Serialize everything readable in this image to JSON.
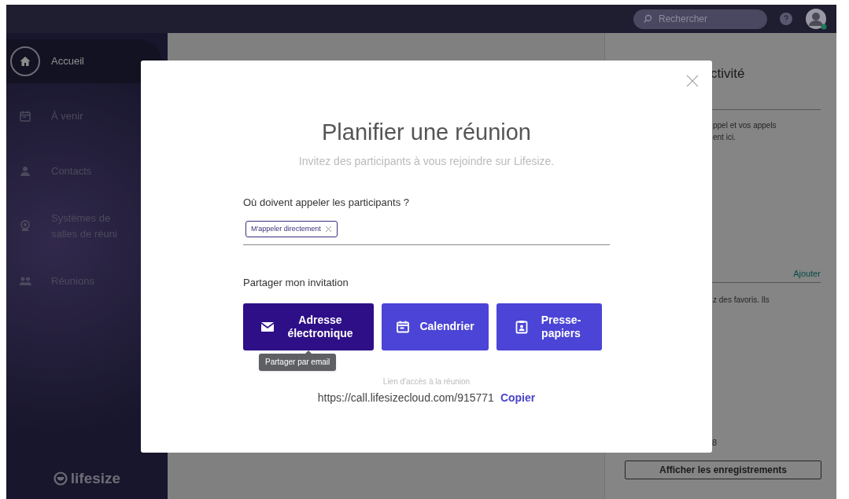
{
  "topbar": {
    "search": {
      "placeholder": "Rechercher"
    }
  },
  "sidebar": {
    "items": [
      {
        "label": "Accueil",
        "kind": "home",
        "selected": true
      },
      {
        "label": "À venir",
        "kind": "calendar",
        "selected": false
      },
      {
        "label": "Contacts",
        "kind": "person",
        "selected": false
      },
      {
        "label": "Systèmes de salles de réuni",
        "kind": "webcam",
        "selected": false
      },
      {
        "label": "Réunions",
        "kind": "group",
        "selected": false
      }
    ],
    "logo": "lifesize"
  },
  "right_panel": {
    "heading": "ctivité",
    "text_1": "ppel et vos appels",
    "text_2": "ent ici.",
    "link": "Ajouter",
    "text_3": "z des favoris. Ils",
    "text_4": "8",
    "button": "Afficher les enregistrements"
  },
  "modal": {
    "title": "Planifier une réunion",
    "subtitle": "Invitez des participants à vous rejoindre sur Lifesize.",
    "question": "Où doivent appeler les participants ?",
    "chip": "M'appeler directement",
    "share_label": "Partager mon invitation",
    "share_buttons": [
      {
        "label": "Adresse électronique",
        "kind": "email",
        "selected": true
      },
      {
        "label": "Calendrier",
        "kind": "calendar",
        "selected": false
      },
      {
        "label": "Presse-papiers",
        "kind": "clipboard",
        "selected": false
      }
    ],
    "tooltip": "Partager par email",
    "link_label": "Lien d'accès à la réunion",
    "link": "https://call.lifesizecloud.com/915771",
    "copy": "Copier"
  }
}
